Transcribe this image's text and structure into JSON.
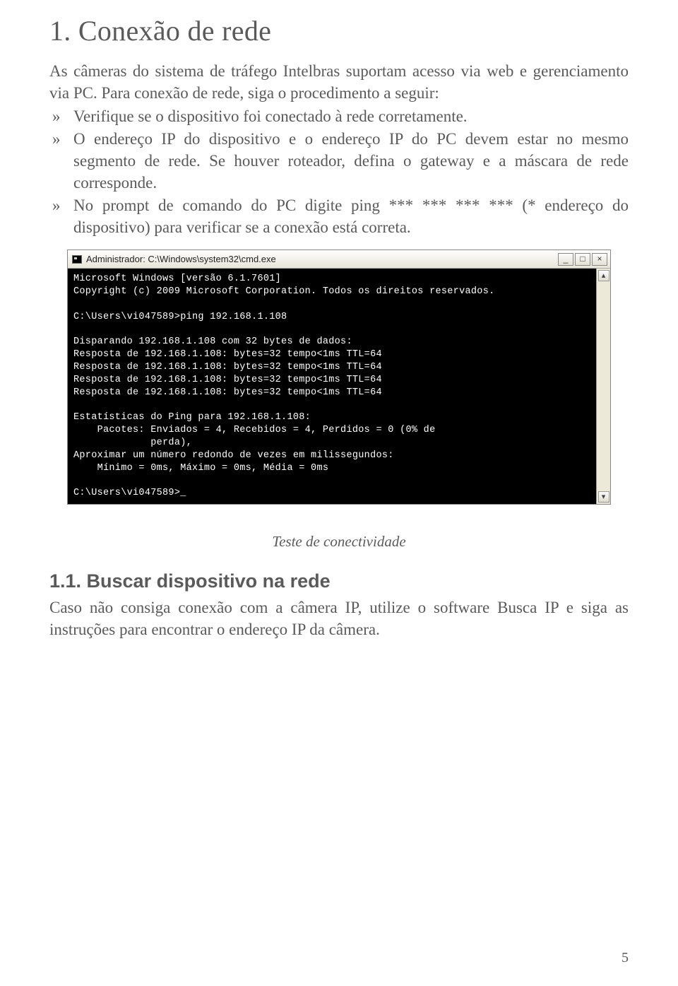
{
  "heading": "1. Conexão de rede",
  "intro": "As câmeras do sistema de tráfego Intelbras suportam acesso via web e gerenciamento via PC. Para conexão de rede, siga o procedimento a seguir:",
  "bullets": [
    "Verifique se o dispositivo foi conectado à rede corretamente.",
    "O endereço IP do dispositivo e o endereço IP do PC devem estar no mesmo segmento de rede. Se houver roteador, defina o gateway e a máscara de rede corresponde.",
    "No prompt de comando do PC digite ping *** *** *** *** (* endereço do dispositivo) para verificar se a conexão está correta."
  ],
  "cmd": {
    "title": "Administrador: C:\\Windows\\system32\\cmd.exe",
    "buttons": {
      "min": "_",
      "max": "□",
      "close": "×"
    },
    "scroll": {
      "up": "▴",
      "down": "▾"
    },
    "lines": [
      "Microsoft Windows [versão 6.1.7601]",
      "Copyright (c) 2009 Microsoft Corporation. Todos os direitos reservados.",
      "",
      "C:\\Users\\vi047589>ping 192.168.1.108",
      "",
      "Disparando 192.168.1.108 com 32 bytes de dados:",
      "Resposta de 192.168.1.108: bytes=32 tempo<1ms TTL=64",
      "Resposta de 192.168.1.108: bytes=32 tempo<1ms TTL=64",
      "Resposta de 192.168.1.108: bytes=32 tempo<1ms TTL=64",
      "Resposta de 192.168.1.108: bytes=32 tempo<1ms TTL=64",
      "",
      "Estatísticas do Ping para 192.168.1.108:",
      "    Pacotes: Enviados = 4, Recebidos = 4, Perdidos = 0 (0% de",
      "             perda),",
      "Aproximar um número redondo de vezes em milissegundos:",
      "    Mínimo = 0ms, Máximo = 0ms, Média = 0ms",
      "",
      "C:\\Users\\vi047589>_"
    ]
  },
  "caption": "Teste de conectividade",
  "subheading": "1.1. Buscar dispositivo na rede",
  "subbody": "Caso não consiga conexão com a câmera IP, utilize o software Busca IP e siga as instruções para encontrar o endereço IP da câmera.",
  "page_number": "5"
}
